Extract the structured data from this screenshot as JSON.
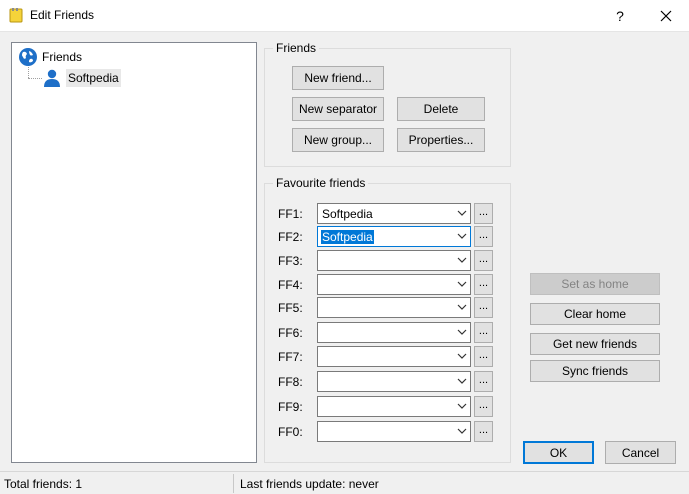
{
  "window": {
    "title": "Edit Friends",
    "help_glyph": "?",
    "close_glyph": "✕"
  },
  "tree": {
    "root_label": "Friends",
    "child_label": "Softpedia"
  },
  "friends_group": {
    "title": "Friends",
    "new_friend": "New friend...",
    "new_separator": "New separator",
    "delete": "Delete",
    "new_group": "New group...",
    "properties": "Properties..."
  },
  "favourites_group": {
    "title": "Favourite friends",
    "browse_label": "...",
    "rows": [
      {
        "label": "FF1:",
        "value": "Softpedia"
      },
      {
        "label": "FF2:",
        "value": "Softpedia"
      },
      {
        "label": "FF3:",
        "value": ""
      },
      {
        "label": "FF4:",
        "value": ""
      },
      {
        "label": "FF5:",
        "value": ""
      },
      {
        "label": "FF6:",
        "value": ""
      },
      {
        "label": "FF7:",
        "value": ""
      },
      {
        "label": "FF8:",
        "value": ""
      },
      {
        "label": "FF9:",
        "value": ""
      },
      {
        "label": "FF0:",
        "value": ""
      }
    ]
  },
  "side_buttons": {
    "set_as_home": "Set as home",
    "clear_home": "Clear home",
    "get_new_friends": "Get new friends",
    "sync_friends": "Sync friends"
  },
  "dialog_buttons": {
    "ok": "OK",
    "cancel": "Cancel"
  },
  "status": {
    "total": "Total friends: 1",
    "last_update": "Last friends update: never"
  },
  "colors": {
    "accent": "#0078d7",
    "globe": "#1e6fc8",
    "person": "#1e6fc8",
    "app_icon": "#f5d33a"
  }
}
